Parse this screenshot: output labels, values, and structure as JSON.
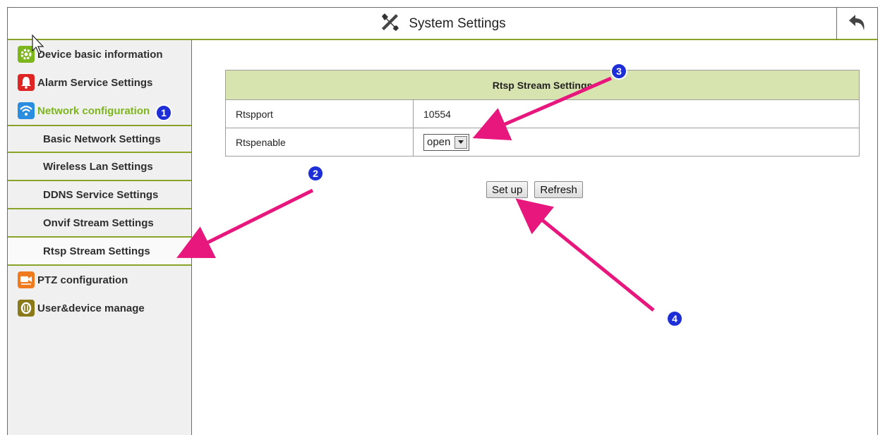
{
  "header": {
    "title": "System Settings",
    "title_icon": "tools-icon",
    "back_icon": "back-arrow-icon"
  },
  "sidebar": {
    "items": [
      {
        "label": "Device basic information",
        "icon": "gear-icon",
        "color": "#7db61c"
      },
      {
        "label": "Alarm Service Settings",
        "icon": "bell-icon",
        "color": "#e02525"
      },
      {
        "label": "Network configuration",
        "icon": "wifi-icon",
        "color": "#2a8de0",
        "active": true
      },
      {
        "label": "PTZ configuration",
        "icon": "camera-icon",
        "color": "#f07a1e"
      },
      {
        "label": "User&device manage",
        "icon": "user-icon",
        "color": "#8a7a1a"
      }
    ],
    "subitems": [
      "Basic Network Settings",
      "Wireless Lan Settings",
      "DDNS Service Settings",
      "Onvif Stream Settings",
      "Rtsp Stream Settings"
    ]
  },
  "panel": {
    "title": "Rtsp Stream Settings",
    "rows": [
      {
        "label": "Rtspport",
        "value": "10554"
      },
      {
        "label": "Rtspenable",
        "value": "open"
      }
    ],
    "setup_label": "Set up",
    "refresh_label": "Refresh"
  },
  "annotations": {
    "badges": [
      "1",
      "2",
      "3",
      "4"
    ],
    "color": "#e8177d"
  },
  "colors": {
    "accent_green": "#8aa329",
    "header_bg": "#d7e4b0",
    "active_text": "#7db61c"
  }
}
